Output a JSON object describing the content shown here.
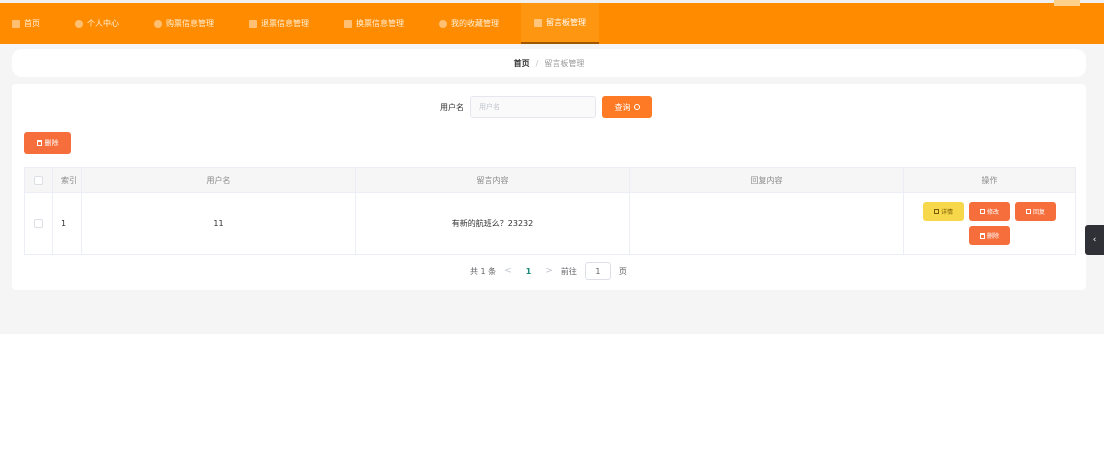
{
  "nav": {
    "items": [
      {
        "label": "首页",
        "icon": "home-icon"
      },
      {
        "label": "个人中心",
        "icon": "user-icon"
      },
      {
        "label": "购票信息管理",
        "icon": "ticket-icon"
      },
      {
        "label": "退票信息管理",
        "icon": "refund-icon"
      },
      {
        "label": "换票信息管理",
        "icon": "grid-icon"
      },
      {
        "label": "我的收藏管理",
        "icon": "star-icon"
      },
      {
        "label": "留言板管理",
        "icon": "message-icon"
      }
    ],
    "active_index": 6
  },
  "breadcrumb": {
    "home": "首页",
    "separator": "/",
    "current": "留言板管理"
  },
  "search": {
    "label": "用户名",
    "placeholder": "用户名",
    "value": "",
    "button_label": "查询"
  },
  "toolbar": {
    "delete_label": "删除"
  },
  "table": {
    "headers": {
      "index": "索引",
      "username": "用户名",
      "content": "留言内容",
      "reply": "回复内容",
      "actions": "操作"
    },
    "rows": [
      {
        "index": "1",
        "username": "11",
        "content": "有新的航班么？23232",
        "reply": ""
      }
    ],
    "row_actions": {
      "detail": "详情",
      "edit": "修改",
      "reply": "回复",
      "delete": "删除"
    }
  },
  "pagination": {
    "total_text": "共 1 条",
    "prev": "<",
    "current": "1",
    "next": ">",
    "goto_label": "前往",
    "goto_value": "1",
    "page_suffix": "页"
  },
  "side_tab": {
    "icon": "chevron-left-icon",
    "glyph": "‹"
  },
  "colors": {
    "nav_bg": "#ff8c00",
    "primary_button": "#f56e3c",
    "search_button": "#ff7a24",
    "detail_button": "#f7d84a",
    "page_current": "#1a8a7a"
  }
}
